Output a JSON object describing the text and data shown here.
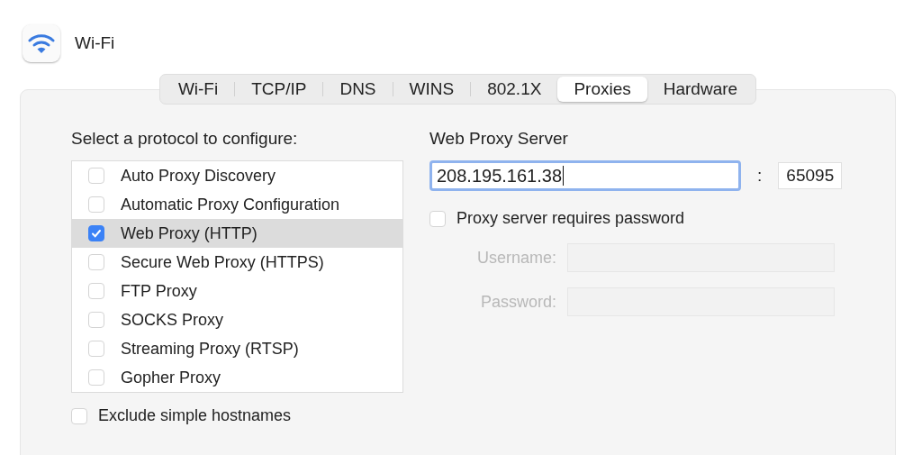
{
  "window": {
    "title": "Wi-Fi"
  },
  "tabs": [
    {
      "label": "Wi-Fi",
      "selected": false
    },
    {
      "label": "TCP/IP",
      "selected": false
    },
    {
      "label": "DNS",
      "selected": false
    },
    {
      "label": "WINS",
      "selected": false
    },
    {
      "label": "802.1X",
      "selected": false
    },
    {
      "label": "Proxies",
      "selected": true
    },
    {
      "label": "Hardware",
      "selected": false
    }
  ],
  "protocols": {
    "heading": "Select a protocol to configure:",
    "items": [
      {
        "label": "Auto Proxy Discovery",
        "checked": false,
        "selected": false
      },
      {
        "label": "Automatic Proxy Configuration",
        "checked": false,
        "selected": false
      },
      {
        "label": "Web Proxy (HTTP)",
        "checked": true,
        "selected": true
      },
      {
        "label": "Secure Web Proxy (HTTPS)",
        "checked": false,
        "selected": false
      },
      {
        "label": "FTP Proxy",
        "checked": false,
        "selected": false
      },
      {
        "label": "SOCKS Proxy",
        "checked": false,
        "selected": false
      },
      {
        "label": "Streaming Proxy (RTSP)",
        "checked": false,
        "selected": false
      },
      {
        "label": "Gopher Proxy",
        "checked": false,
        "selected": false
      }
    ]
  },
  "exclude_simple_hostnames": {
    "label": "Exclude simple hostnames",
    "checked": false
  },
  "server": {
    "heading": "Web Proxy Server",
    "host": "208.195.161.38",
    "separator": ":",
    "port": "65095",
    "requires_password": {
      "label": "Proxy server requires password",
      "checked": false
    },
    "credentials": [
      {
        "label": "Username:",
        "disabled": true
      },
      {
        "label": "Password:",
        "disabled": true
      }
    ]
  }
}
